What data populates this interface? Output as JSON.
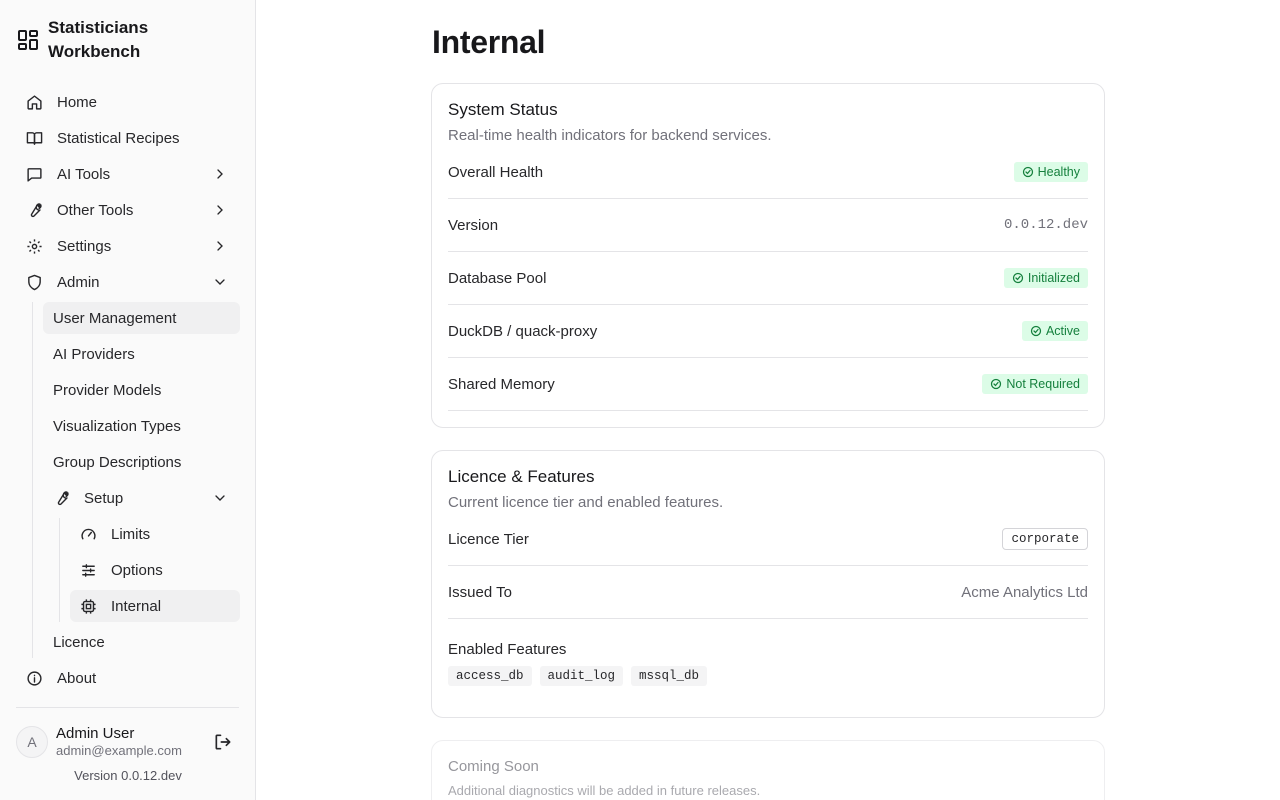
{
  "app": {
    "title": "Statisticians Workbench",
    "logo_icon": "dashboard-grid-icon"
  },
  "sidebar": {
    "items": [
      {
        "label": "Home",
        "icon": "home-icon"
      },
      {
        "label": "Statistical Recipes",
        "icon": "book-icon"
      },
      {
        "label": "AI Tools",
        "icon": "message-icon",
        "expandable": true
      },
      {
        "label": "Other Tools",
        "icon": "wrench-icon",
        "expandable": true
      },
      {
        "label": "Settings",
        "icon": "gear-icon",
        "expandable": true
      },
      {
        "label": "Admin",
        "icon": "shield-icon",
        "expanded": true
      }
    ],
    "admin_items": [
      {
        "label": "User Management"
      },
      {
        "label": "AI Providers"
      },
      {
        "label": "Provider Models"
      },
      {
        "label": "Visualization Types"
      },
      {
        "label": "Group Descriptions"
      }
    ],
    "setup": {
      "label": "Setup",
      "icon": "wrench-icon"
    },
    "setup_items": [
      {
        "label": "Limits",
        "icon": "gauge-icon"
      },
      {
        "label": "Options",
        "icon": "sliders-icon"
      },
      {
        "label": "Internal",
        "icon": "chip-icon",
        "active": true
      }
    ],
    "licence": {
      "label": "Licence"
    },
    "about": {
      "label": "About",
      "icon": "info-icon"
    }
  },
  "user": {
    "initial": "A",
    "name": "Admin User",
    "email": "admin@example.com"
  },
  "version_label": "Version 0.0.12.dev",
  "page": {
    "title": "Internal"
  },
  "system_status": {
    "title": "System Status",
    "description": "Real-time health indicators for backend services.",
    "rows": [
      {
        "label": "Overall Health",
        "value": "Healthy",
        "kind": "badge"
      },
      {
        "label": "Version",
        "value": "0.0.12.dev",
        "kind": "mono"
      },
      {
        "label": "Database Pool",
        "value": "Initialized",
        "kind": "badge"
      },
      {
        "label": "DuckDB / quack-proxy",
        "value": "Active",
        "kind": "badge"
      },
      {
        "label": "Shared Memory",
        "value": "Not Required",
        "kind": "badge"
      }
    ]
  },
  "licence_features": {
    "title": "Licence & Features",
    "description": "Current licence tier and enabled features.",
    "tier_label": "Licence Tier",
    "tier_value": "corporate",
    "issued_label": "Issued To",
    "issued_value": "Acme Analytics Ltd",
    "features_label": "Enabled Features",
    "features": [
      "access_db",
      "audit_log",
      "mssql_db"
    ]
  },
  "coming_soon": {
    "title": "Coming Soon",
    "description": "Additional diagnostics will be added in future releases."
  },
  "colors": {
    "badge_bg": "#dcfce7",
    "badge_text": "#15803d",
    "border": "#e4e4e7"
  }
}
